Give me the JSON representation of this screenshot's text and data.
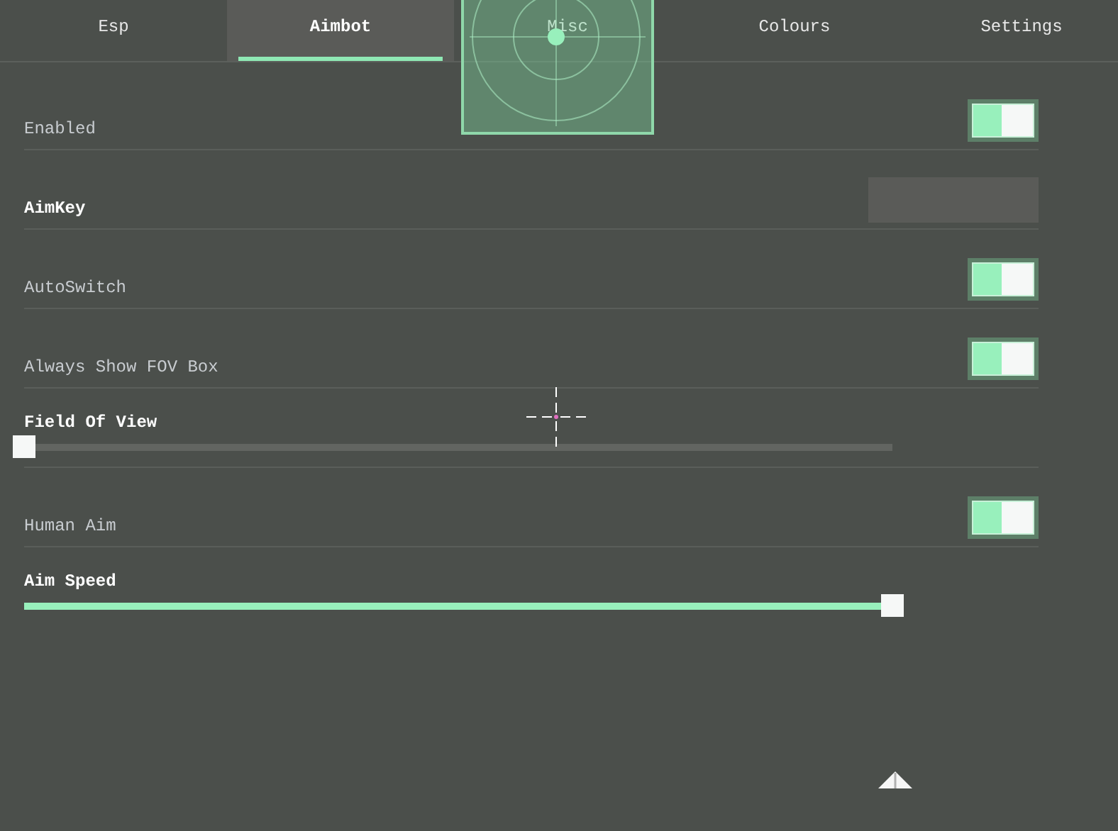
{
  "tabs": [
    {
      "label": "Esp",
      "selected": false
    },
    {
      "label": "Aimbot",
      "selected": true
    },
    {
      "label": "Misc",
      "selected": false
    },
    {
      "label": "Colours",
      "selected": false
    },
    {
      "label": "Settings",
      "selected": false
    }
  ],
  "rows": [
    {
      "kind": "toggle",
      "label": "Enabled",
      "on": true
    },
    {
      "kind": "key",
      "label": "AimKey"
    },
    {
      "kind": "toggle",
      "label": "AutoSwitch",
      "on": true
    },
    {
      "kind": "toggle",
      "label": "Always Show FOV Box",
      "on": true
    },
    {
      "kind": "slider",
      "label": "Field Of View",
      "level": 0
    },
    {
      "kind": "toggle",
      "label": "Human Aim",
      "on": true
    },
    {
      "kind": "slider",
      "label": "Aim Speed",
      "level": 1
    }
  ]
}
